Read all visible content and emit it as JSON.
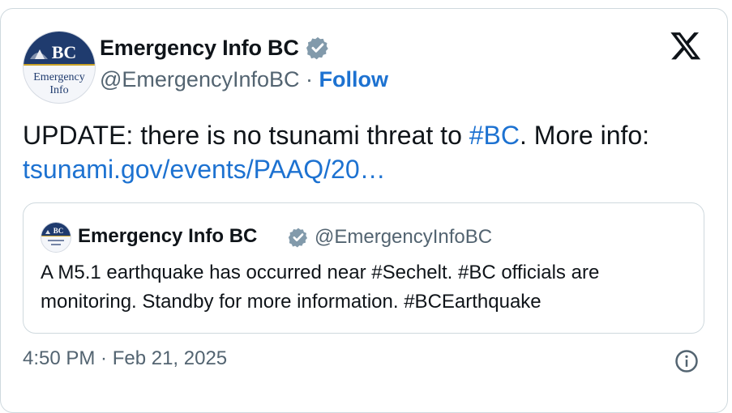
{
  "author": {
    "name": "Emergency Info BC",
    "handle": "@EmergencyInfoBC",
    "separator": "·",
    "follow_label": "Follow",
    "avatar": {
      "logo_text_top": "BC",
      "logo_text_line1": "Emergency",
      "logo_text_line2": "Info"
    }
  },
  "tweet": {
    "text_part1": "UPDATE: there is no tsunami threat to ",
    "hashtag": "#BC",
    "text_part2": ". More info: ",
    "link": "tsunami.gov/events/PAAQ/20…"
  },
  "quoted_tweet": {
    "name": "Emergency Info BC",
    "handle": "@EmergencyInfoBC",
    "text": "A M5.1 earthquake has occurred near #Sechelt. #BC officials are monitoring. Standby for more information. #BCEarthquake",
    "avatar_text": "BC"
  },
  "footer": {
    "timestamp": "4:50 PM · Feb 21, 2025"
  },
  "icons": {
    "verified": "verified-badge-icon",
    "platform": "x-logo-icon",
    "info": "info-icon"
  },
  "colors": {
    "link": "#1d72d1",
    "secondary_text": "#536471",
    "border": "#cfd9de",
    "logo_navy": "#1f3b6e"
  }
}
